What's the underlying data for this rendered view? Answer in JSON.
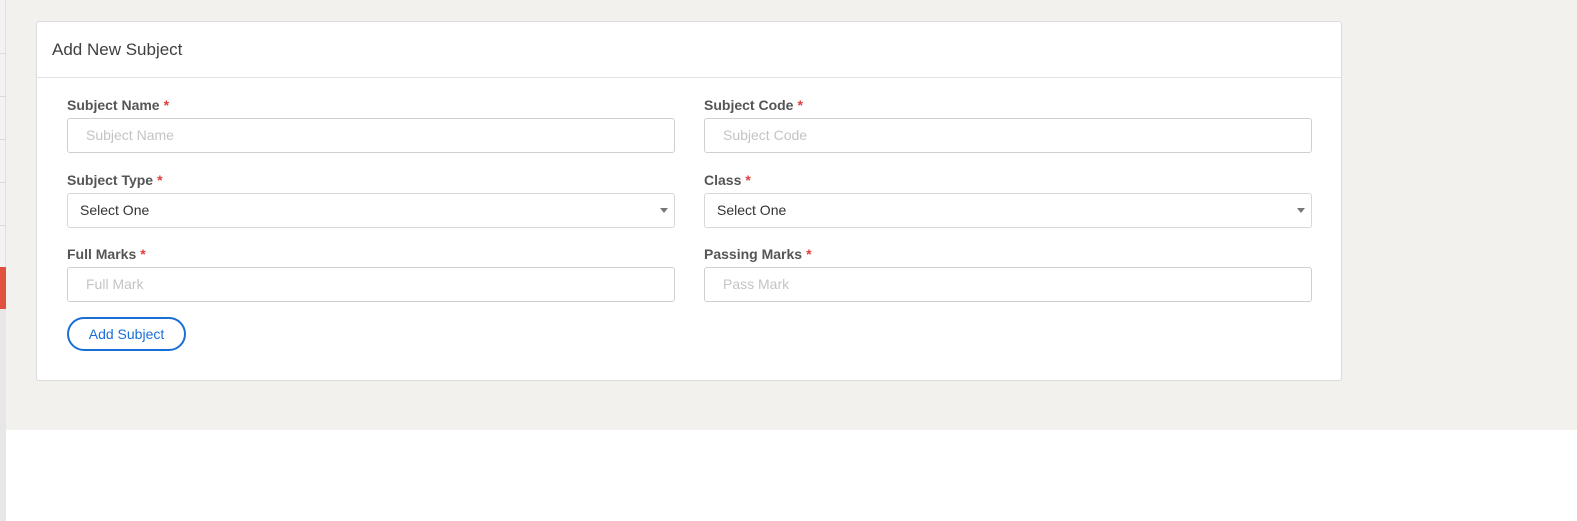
{
  "form": {
    "title": "Add New Subject",
    "required_mark": "*",
    "subject_name": {
      "label": "Subject Name",
      "placeholder": "Subject Name",
      "value": ""
    },
    "subject_code": {
      "label": "Subject Code",
      "placeholder": "Subject Code",
      "value": ""
    },
    "subject_type": {
      "label": "Subject Type",
      "selected": "Select One"
    },
    "class": {
      "label": "Class",
      "selected": "Select One"
    },
    "full_marks": {
      "label": "Full Marks",
      "placeholder": "Full Mark",
      "value": ""
    },
    "passing_marks": {
      "label": "Passing Marks",
      "placeholder": "Pass Mark",
      "value": ""
    },
    "submit_label": "Add Subject"
  },
  "icons": {
    "select_arrow": "caret-down-icon"
  },
  "colors": {
    "accent": "#1a6fd6",
    "required": "#e23d3d",
    "sidebar_active": "#e2503f",
    "page_background": "#f2f1ee"
  }
}
